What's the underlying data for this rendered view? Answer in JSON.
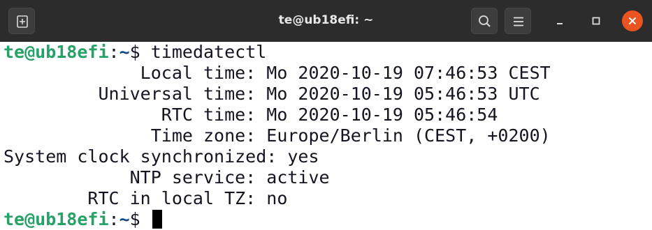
{
  "window": {
    "title": "te@ub18efi: ~",
    "buttons": {
      "new_tab_icon": "new-tab-icon",
      "search_icon": "search-icon",
      "menu_icon": "hamburger-menu-icon",
      "minimize_icon": "minimize-icon",
      "maximize_icon": "maximize-icon",
      "close_icon": "close-icon"
    },
    "colors": {
      "titlebar": "#2c2c2c",
      "close_button": "#e95420",
      "prompt_user": "#26a269",
      "prompt_path": "#12488b"
    }
  },
  "terminal": {
    "prompt1": {
      "user_host": "te@ub18efi",
      "sep": ":",
      "path": "~",
      "symbol": "$",
      "command": " timedatectl"
    },
    "output": [
      "             Local time: Mo 2020-10-19 07:46:53 CEST",
      "         Universal time: Mo 2020-10-19 05:46:53 UTC",
      "               RTC time: Mo 2020-10-19 05:46:54",
      "              Time zone: Europe/Berlin (CEST, +0200)",
      "System clock synchronized: yes",
      "            NTP service: active",
      "        RTC in local TZ: no"
    ],
    "prompt2": {
      "user_host": "te@ub18efi",
      "sep": ":",
      "path": "~",
      "symbol": "$ "
    }
  }
}
